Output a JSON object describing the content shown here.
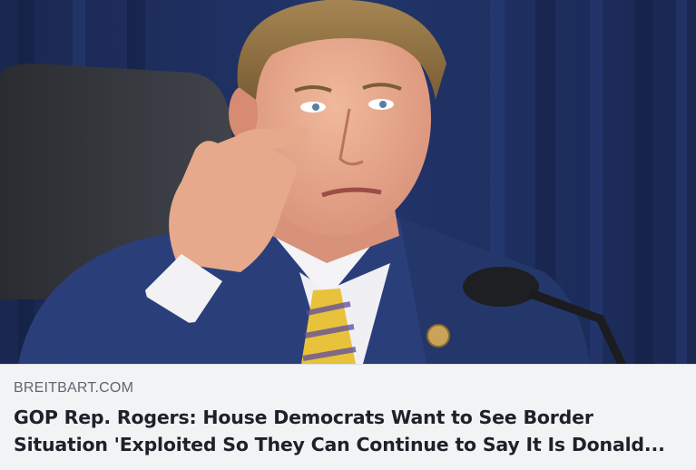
{
  "link_preview": {
    "domain": "BREITBART.COM",
    "headline": "GOP Rep. Rogers: House Democrats Want to See Border Situation 'Exploited So They Can Continue to Say It Is Donald...",
    "image_alt": "Man in blue suit and gold striped tie gesturing at a hearing microphone"
  },
  "colors": {
    "meta_background": "#f2f3f5",
    "domain_text": "#606770",
    "headline_text": "#1d2129",
    "curtain": "#1e2d5a",
    "suit": "#2a3f7a",
    "tie": "#e8c23a"
  }
}
